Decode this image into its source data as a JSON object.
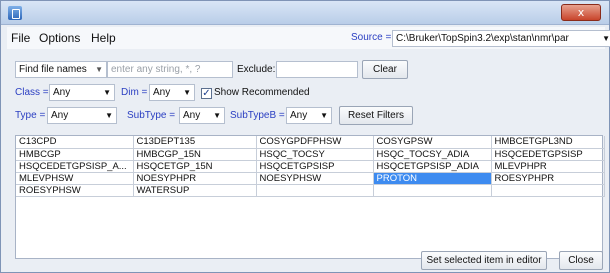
{
  "window": {
    "close_glyph": "x"
  },
  "menu": {
    "file": "File",
    "options": "Options",
    "help": "Help"
  },
  "source": {
    "label": "Source =",
    "value": "C:\\Bruker\\TopSpin3.2\\exp\\stan\\nmr\\par"
  },
  "find": {
    "mode": "Find file names",
    "placeholder": "enter any string, *, ?",
    "exclude_label": "Exclude:",
    "clear_label": "Clear"
  },
  "filters": {
    "class_label": "Class =",
    "class_value": "Any",
    "dim_label": "Dim =",
    "dim_value": "Any",
    "show_recommended_label": "Show Recommended",
    "show_recommended_checked": true,
    "type_label": "Type =",
    "type_value": "Any",
    "subtype_label": "SubType =",
    "subtype_value": "Any",
    "subtypeb_label": "SubTypeB =",
    "subtypeb_value": "Any",
    "reset_label": "Reset Filters"
  },
  "grid": {
    "rows": [
      [
        "C13CPD",
        "C13DEPT135",
        "COSYGPDFPHSW",
        "COSYGPSW",
        "HMBCETGPL3ND"
      ],
      [
        "HMBCGP",
        "HMBCGP_15N",
        "HSQC_TOCSY",
        "HSQC_TOCSY_ADIA",
        "HSQCEDETGPSISP"
      ],
      [
        "HSQCEDETGPSISP_A...",
        "HSQCETGP_15N",
        "HSQCETGPSISP",
        "HSQCETGPSISP_ADIA",
        "MLEVPHPR"
      ],
      [
        "MLEVPHSW",
        "NOESYPHPR",
        "NOESYPHSW",
        "PROTON",
        "ROESYPHPR"
      ],
      [
        "ROESYPHSW",
        "WATERSUP",
        "",
        "",
        ""
      ]
    ],
    "selected": "PROTON",
    "selection_color": "#3d8bf0"
  },
  "footer": {
    "set_label": "Set selected item in editor",
    "close_label": "Close"
  },
  "colors": {
    "accent_blue": "#2b3fc2",
    "title_bar": "#c9daf1",
    "close_red": "#c8442b"
  }
}
